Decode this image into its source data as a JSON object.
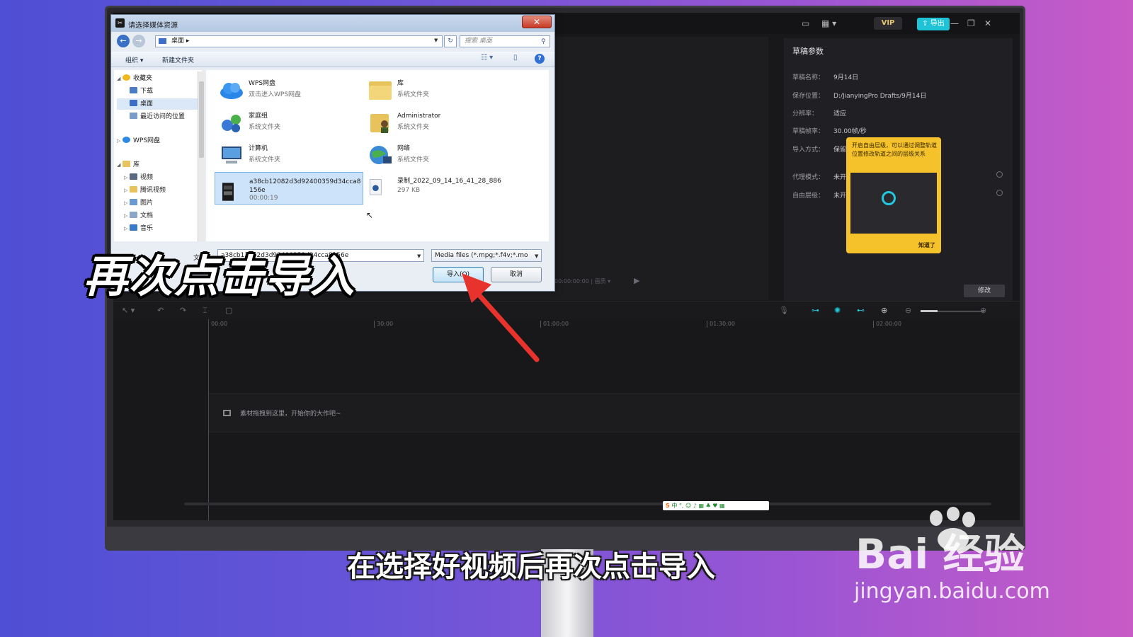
{
  "dialog": {
    "title": "请选择媒体资源",
    "close_label": "✕",
    "address": "桌面",
    "search_placeholder": "搜索 桌面",
    "toolbar": {
      "organize": "组织 ▾",
      "new_folder": "新建文件夹"
    },
    "nav": [
      {
        "label": "收藏夹"
      },
      {
        "label": "下载"
      },
      {
        "label": "桌面"
      },
      {
        "label": "最近访问的位置"
      },
      {
        "label": "WPS网盘"
      },
      {
        "label": "库"
      },
      {
        "label": "视频"
      },
      {
        "label": "腾讯视频"
      },
      {
        "label": "图片"
      },
      {
        "label": "文档"
      },
      {
        "label": "音乐"
      }
    ],
    "files": [
      {
        "name": "WPS网盘",
        "sub": "双击进入WPS网盘"
      },
      {
        "name": "库",
        "sub": "系统文件夹"
      },
      {
        "name": "家庭组",
        "sub": "系统文件夹"
      },
      {
        "name": "Administrator",
        "sub": "系统文件夹"
      },
      {
        "name": "计算机",
        "sub": "系统文件夹"
      },
      {
        "name": "网络",
        "sub": "系统文件夹"
      },
      {
        "name": "a38cb12082d3d92400359d34cca8156e",
        "sub": "00:00:19"
      },
      {
        "name": "录制_2022_09_14_16_41_28_886",
        "sub": "297 KB"
      }
    ],
    "filename_label": "文件",
    "filename_value": "a38cb12082d3d92400359d34cca8156e",
    "filetype": "Media files (*.mpg;*.f4v;*.mo",
    "import_label": "导入(O)",
    "cancel_label": "取消"
  },
  "app": {
    "vip_label": "VIP",
    "export_label": "导出",
    "params": {
      "title": "草稿参数",
      "rows": [
        {
          "k": "草稿名称：",
          "v": "9月14日"
        },
        {
          "k": "保存位置：",
          "v": "D:/JianyingPro Drafts/9月14日"
        },
        {
          "k": "分辨率：",
          "v": "适应"
        },
        {
          "k": "草稿帧率：",
          "v": "30.00帧/秒"
        },
        {
          "k": "导入方式：",
          "v": "保留在原"
        },
        {
          "k": "代理模式：",
          "v": "未开启"
        },
        {
          "k": "自由层级：",
          "v": "未开启"
        }
      ],
      "modify_label": "修改"
    },
    "tooltip": {
      "text": "开启自由层级，可以通过调整轨道位置修改轨道之间的层级关系",
      "ok": "知道了"
    },
    "ruler": [
      "00:00",
      "30:00",
      "01:00:00",
      "01:30:00",
      "02:00:00"
    ],
    "track_hint": "素材拖拽到这里，开始你的大作吧~"
  },
  "ime_text": "中 °, ☺ ♪ ▦ ♣ ♥ ▦",
  "ime_logo": "S",
  "overlay_caption": "再次点击导入",
  "subtitle": "在选择好视频后再次点击导入",
  "watermark": {
    "logo": "Bai  经验",
    "url": "jingyan.baidu.com"
  },
  "colors": {
    "accent": "#21c8e0",
    "arrow": "#e8322c",
    "tooltip": "#f6c22c"
  }
}
